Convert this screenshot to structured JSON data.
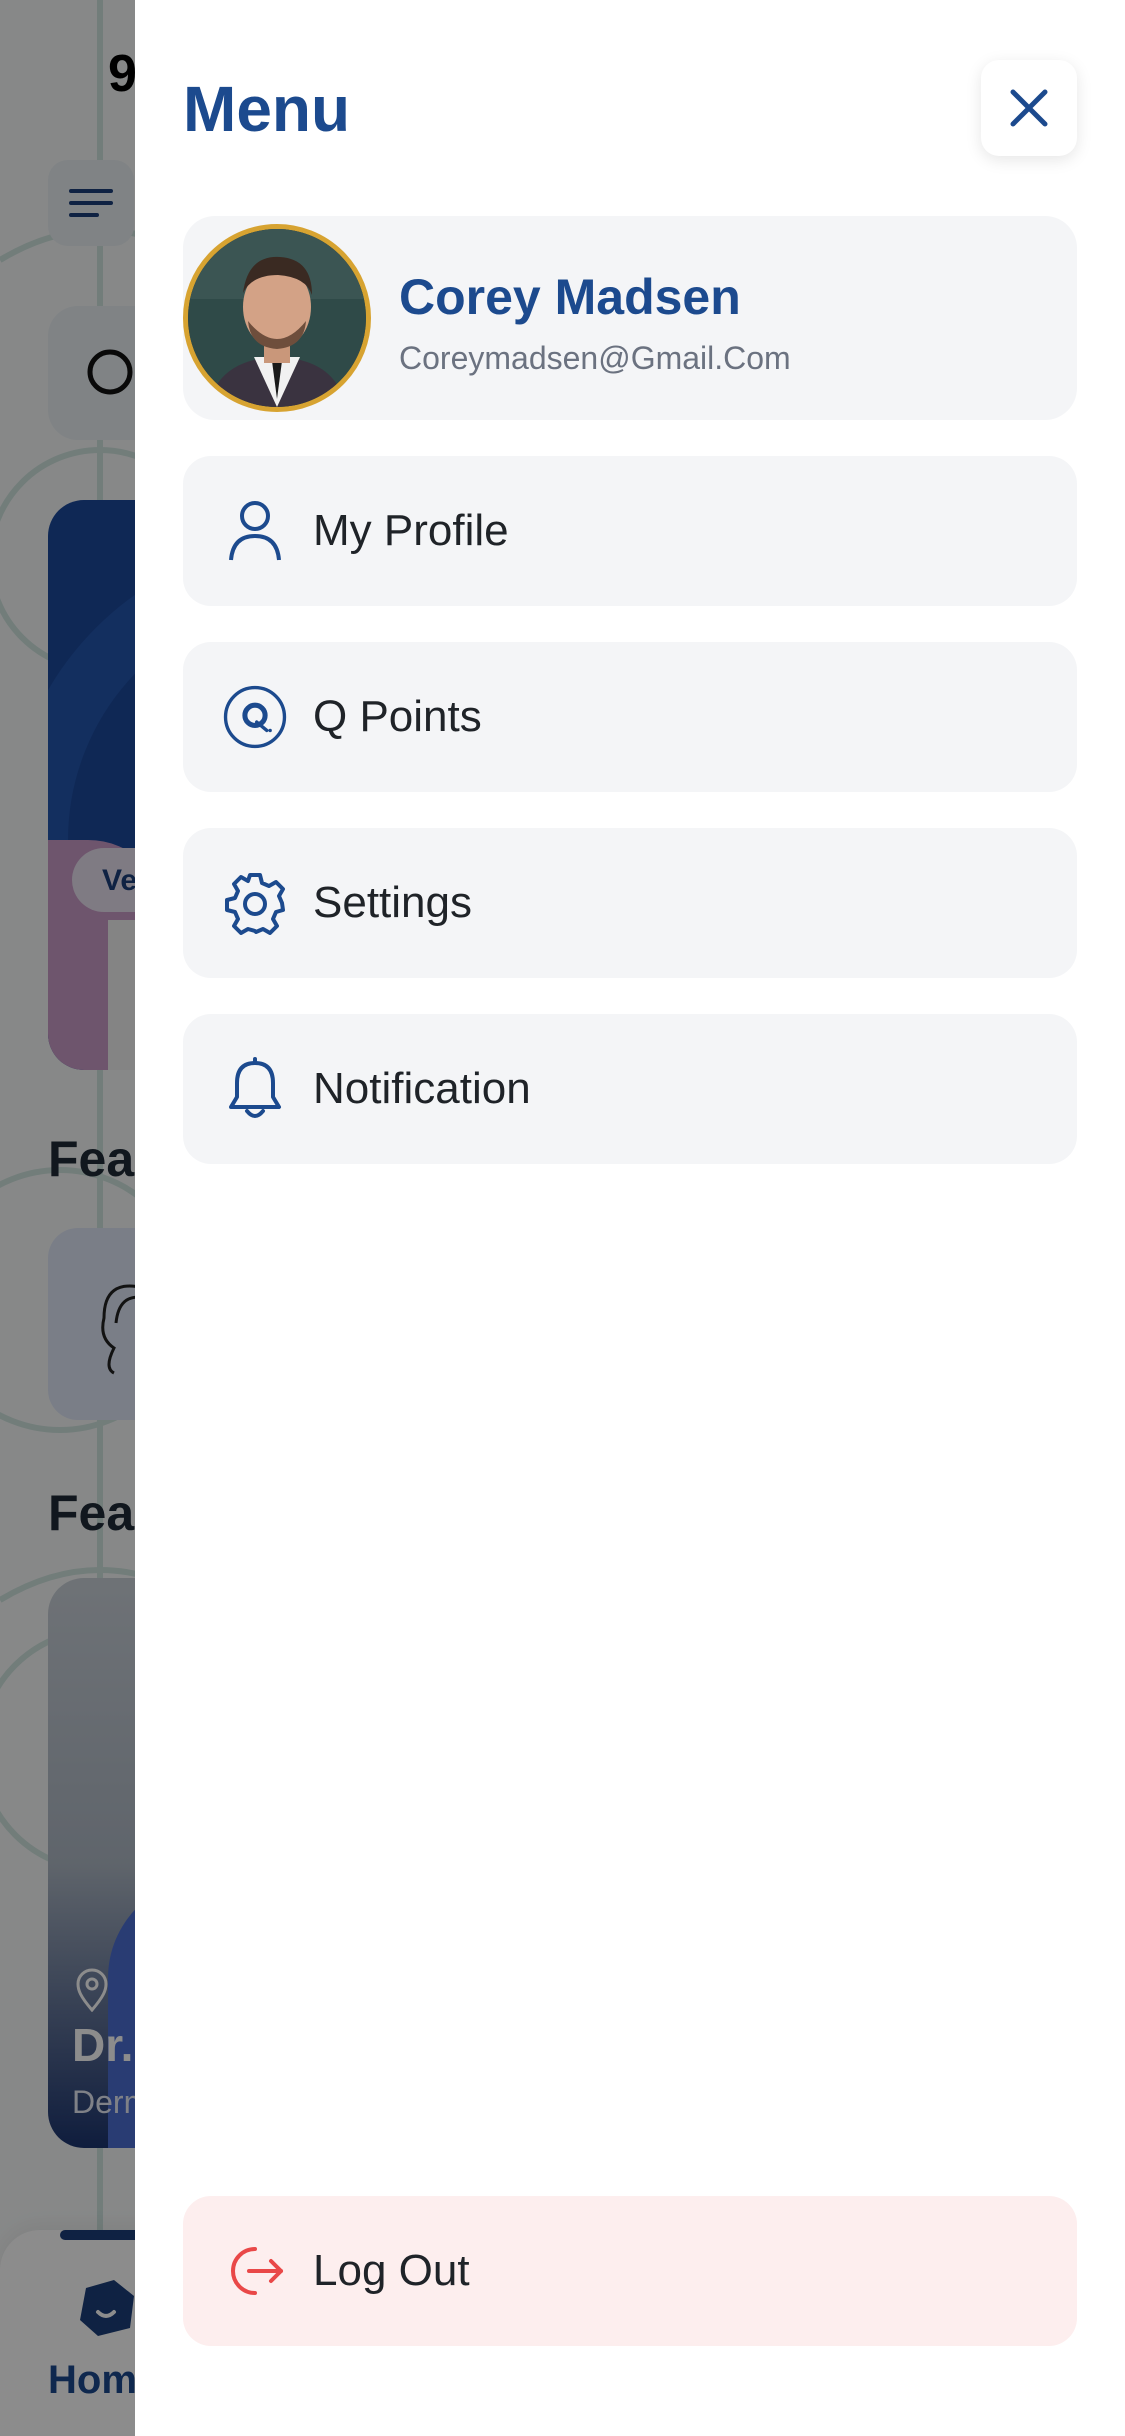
{
  "background": {
    "status_time": "9",
    "banner_pill": "Ve",
    "heading_one": "Fea",
    "heading_two": "Fea",
    "doctor_location": "D",
    "doctor_name": "Dr.",
    "doctor_specialty": "Derm",
    "tab_home": "Hom"
  },
  "drawer": {
    "title": "Menu",
    "close_icon": "close-icon",
    "user": {
      "name": "Corey Madsen",
      "email": "Coreymadsen@Gmail.Com"
    },
    "items": [
      {
        "label": "My Profile",
        "icon": "person-icon"
      },
      {
        "label": "Q Points",
        "icon": "q-points-icon"
      },
      {
        "label": "Settings",
        "icon": "gear-icon"
      },
      {
        "label": "Notification",
        "icon": "bell-icon"
      }
    ],
    "logout": {
      "label": "Log Out",
      "icon": "logout-icon"
    }
  },
  "colors": {
    "brand_blue": "#1c4a8e",
    "card_bg": "#f4f5f7",
    "logout_bg": "#fdeeee",
    "logout_red": "#e94848",
    "avatar_ring": "#d7a331"
  }
}
